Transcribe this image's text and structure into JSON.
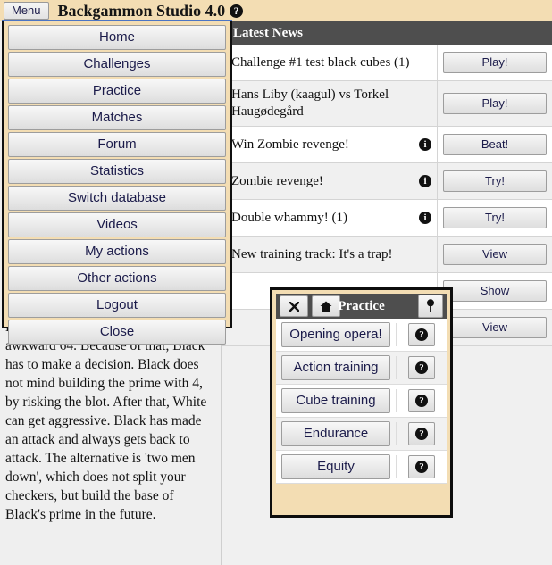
{
  "titlebar": {
    "menu_button": "Menu",
    "app_title": "Backgammon Studio 4.0",
    "help_icon": "question-mark-circle-icon"
  },
  "menu": {
    "items": [
      {
        "label": "Home"
      },
      {
        "label": "Challenges"
      },
      {
        "label": "Practice"
      },
      {
        "label": "Matches"
      },
      {
        "label": "Forum"
      },
      {
        "label": "Statistics"
      },
      {
        "label": "Switch database"
      },
      {
        "label": "Videos"
      },
      {
        "label": "My actions"
      },
      {
        "label": "Other actions"
      },
      {
        "label": "Logout"
      },
      {
        "label": "Close"
      }
    ]
  },
  "news": {
    "header": "Latest News",
    "rows": [
      {
        "text": "Challenge #1 test black cubes (1)",
        "info": false,
        "button": "Play!"
      },
      {
        "text": "Hans Liby (kaagul) vs Torkel Haugødegård",
        "info": false,
        "button": "Play!"
      },
      {
        "text": "Win Zombie revenge!",
        "info": true,
        "button": "Beat!"
      },
      {
        "text": "Zombie revenge!",
        "info": true,
        "button": "Try!"
      },
      {
        "text": "Double whammy! (1)",
        "info": true,
        "button": "Try!"
      },
      {
        "text": "New training track: It's a trap!",
        "info": false,
        "button": "View"
      },
      {
        "text": "",
        "info": false,
        "button": "Show"
      },
      {
        "text": "",
        "info": false,
        "button": "View"
      }
    ]
  },
  "article": {
    "body": "Black to play. White has made an awkward 64. Because of that, Black has to make a decision. Black does not mind building the prime with 4, by risking the blot. After that, White can get aggressive. Black has made an attack and always gets back to attack. The alternative is 'two men down', which does not split your checkers, but build the base of Black's prime in the future."
  },
  "practice_dialog": {
    "title": "Practice",
    "close_icon": "close-x-icon",
    "home_icon": "home-icon",
    "pin_icon": "pin-icon",
    "rows": [
      {
        "label": "Opening opera!",
        "help": "question-mark-circle-icon"
      },
      {
        "label": "Action training",
        "help": "question-mark-circle-icon"
      },
      {
        "label": "Cube training",
        "help": "question-mark-circle-icon"
      },
      {
        "label": "Endurance",
        "help": "question-mark-circle-icon"
      },
      {
        "label": "Equity",
        "help": "question-mark-circle-icon"
      }
    ]
  },
  "colors": {
    "beige": "#f3ddb3",
    "header_gray": "#4e4e4e",
    "button_text": "#1b1b4a",
    "page_gray": "#efefef",
    "accent_blue": "#4a74c4"
  }
}
